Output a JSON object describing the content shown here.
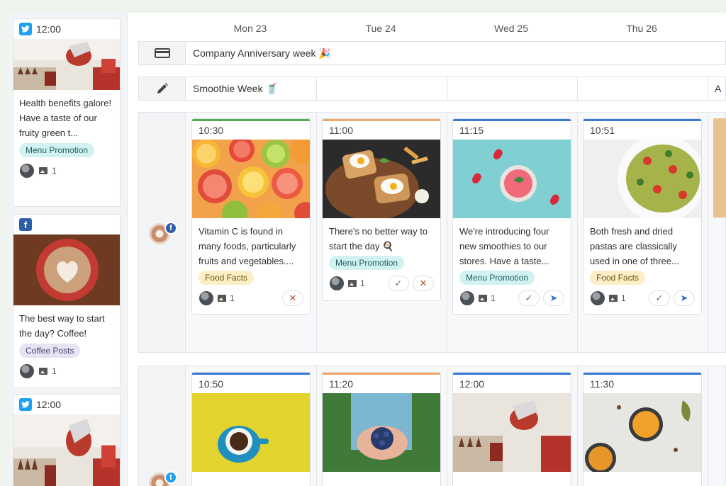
{
  "sidebar": {
    "cards": [
      {
        "network": "twitter",
        "time": "12:00",
        "text": "Health benefits galore! Have a taste of our fruity green t...",
        "tag": "Menu Promotion",
        "image_count": "1"
      },
      {
        "network": "facebook",
        "time": "",
        "text": "The best way to start the day? Coffee!",
        "tag": "Coffee Posts",
        "image_count": "1"
      },
      {
        "network": "twitter",
        "time": "12:00",
        "text": "",
        "tag": "",
        "image_count": ""
      }
    ]
  },
  "calendar": {
    "days": [
      "Mon 23",
      "Tue 24",
      "Wed 25",
      "Thu 26"
    ],
    "bands": [
      {
        "icon": "card-icon",
        "label": "Company Anniversary week 🎉",
        "extra": ""
      },
      {
        "icon": "pencil-icon",
        "label": "Smoothie Week 🥤",
        "extra": "A"
      }
    ],
    "rows": [
      {
        "network": "facebook",
        "posts": [
          {
            "time": "10:30",
            "bar_color": "#4caf50",
            "text": "Vitamin C is found in many foods, particularly fruits and vegetables....",
            "tag": "Food Facts",
            "image_count": "1",
            "actions": [
              "reject"
            ]
          },
          {
            "time": "11:00",
            "bar_color": "#f0a868",
            "text": "There's no better way to start the day 🍳",
            "tag": "Menu Promotion",
            "image_count": "1",
            "actions": [
              "approve",
              "reject"
            ]
          },
          {
            "time": "11:15",
            "bar_color": "#3a7bd5",
            "text": "We're introducing four new smoothies to our stores. Have a taste...",
            "tag": "Menu Promotion",
            "image_count": "1",
            "actions": [
              "approve",
              "send"
            ]
          },
          {
            "time": "10:51",
            "bar_color": "#3a7bd5",
            "text": "Both fresh and dried pastas are classically used in one of three...",
            "tag": "Food Facts",
            "image_count": "1",
            "actions": [
              "approve",
              "send"
            ]
          }
        ]
      },
      {
        "network": "twitter",
        "posts": [
          {
            "time": "10:50",
            "bar_color": "#3a7bd5",
            "text": "",
            "tag": "",
            "image_count": "",
            "actions": []
          },
          {
            "time": "11:20",
            "bar_color": "#f0a868",
            "text": "",
            "tag": "",
            "image_count": "",
            "actions": []
          },
          {
            "time": "12:00",
            "bar_color": "#3a7bd5",
            "text": "",
            "tag": "",
            "image_count": "",
            "actions": []
          },
          {
            "time": "11:30",
            "bar_color": "#3a7bd5",
            "text": "",
            "tag": "",
            "image_count": "",
            "actions": []
          }
        ]
      }
    ]
  },
  "colors": {
    "twitter": "#1da1f2",
    "facebook": "#2d5fa8",
    "send": "#2f6fcf",
    "reject": "#c0502c"
  }
}
